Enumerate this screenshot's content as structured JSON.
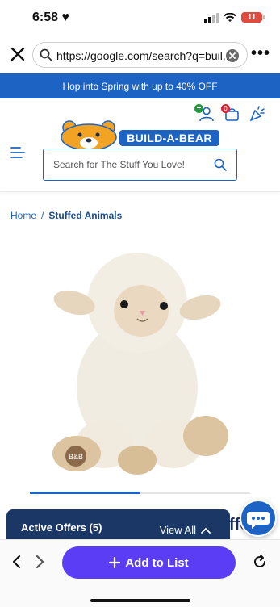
{
  "status_bar": {
    "time": "6:58",
    "battery": "11"
  },
  "browser": {
    "url": "https://google.com/search?q=buil...",
    "icons": [
      "close-icon",
      "search-icon",
      "clear-icon",
      "more-icon"
    ]
  },
  "promo": {
    "text": "Hop into Spring with up to 40% OFF"
  },
  "header": {
    "logo_text": "BUILD-A-BEAR",
    "search_placeholder": "Search for The Stuff You Love!",
    "cart_count": "0",
    "account_badge": "+"
  },
  "breadcrumb": {
    "home": "Home",
    "separator": "/",
    "current": "Stuffed Animals"
  },
  "product": {
    "image_alt": "lamb plush",
    "paw_text": "B&B"
  },
  "carousel": {
    "progress": 0.5
  },
  "offers": {
    "title": "Active Offers (5)",
    "view_all": "View All",
    "peek_text": "ffe"
  },
  "bottom_bar": {
    "add_to_list": "Add to List"
  },
  "colors": {
    "brand_blue": "#1d63c4",
    "navy": "#1b3766",
    "purple": "#5a3df5"
  }
}
